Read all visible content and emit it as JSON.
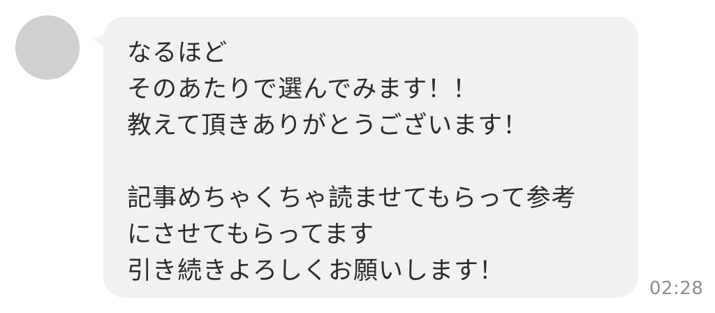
{
  "message": {
    "lines": [
      "なるほど",
      "そのあたりで選んでみます！！",
      "教えて頂きありがとうございます！",
      "",
      "記事めちゃくちゃ読ませてもらって参考",
      "にさせてもらってます",
      "引き続きよろしくお願いします！"
    ],
    "time": "02:28"
  }
}
